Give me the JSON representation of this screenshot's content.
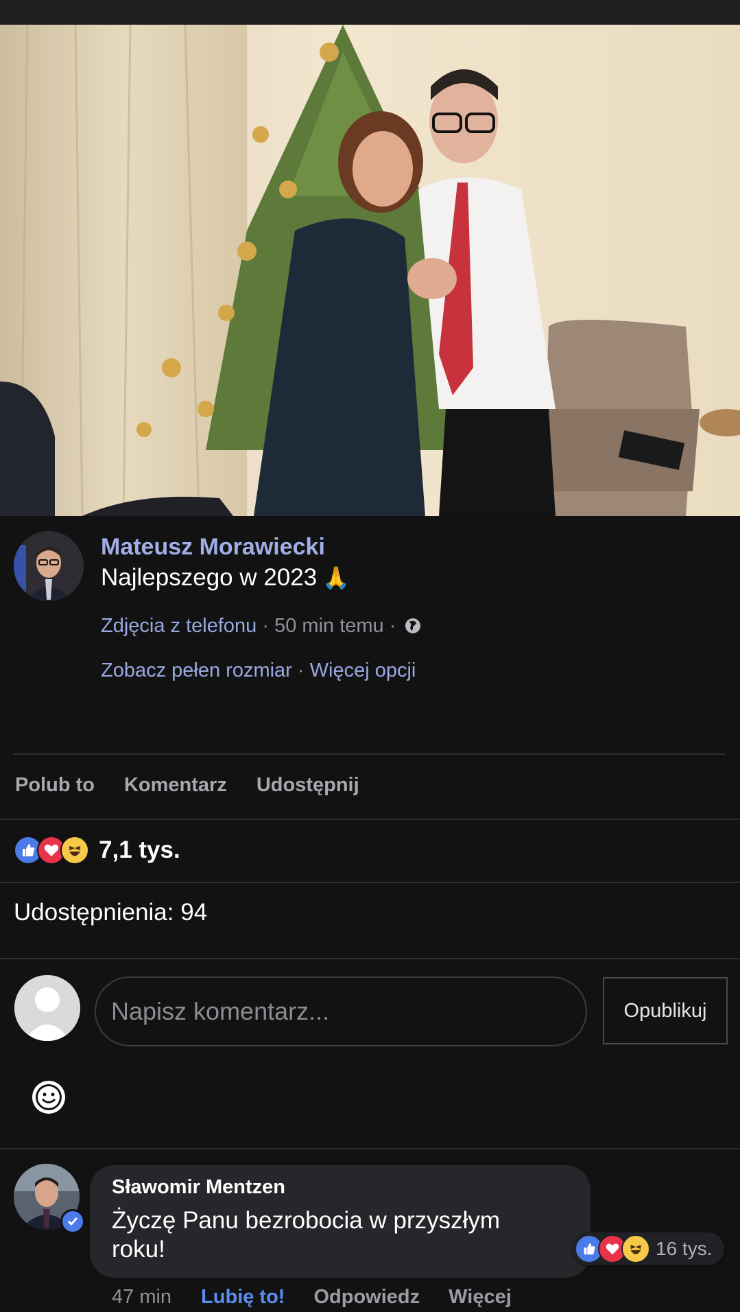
{
  "post": {
    "author": "Mateusz Morawiecki",
    "text": "Najlepszego w 2023",
    "emoji": "🙏",
    "album_link": "Zdjęcia z telefonu",
    "time": "50 min temu",
    "audience_icon": "globe-icon",
    "view_full_size": "Zobacz pełen rozmiar",
    "more_options": "Więcej opcji"
  },
  "actions": {
    "like": "Polub to",
    "comment": "Komentarz",
    "share": "Udostępnij"
  },
  "reactions": {
    "icons": [
      "like-icon",
      "love-icon",
      "haha-icon"
    ],
    "count": "7,1 tys."
  },
  "shares": "Udostępnienia: 94",
  "composer": {
    "placeholder": "Napisz komentarz...",
    "publish": "Opublikuj"
  },
  "comment": {
    "author": "Sławomir Mentzen",
    "text": "Życzę Panu bezrobocia w przyszłym roku!",
    "time": "47 min",
    "like": "Lubię to!",
    "reply": "Odpowiedz",
    "more": "Więcej",
    "reaction_count": "16 tys."
  },
  "colors": {
    "background": "#121212",
    "link": "#a3aee8",
    "like_blue": "#4b7be8",
    "love_red": "#e8334a",
    "haha_yellow": "#f7c948"
  }
}
